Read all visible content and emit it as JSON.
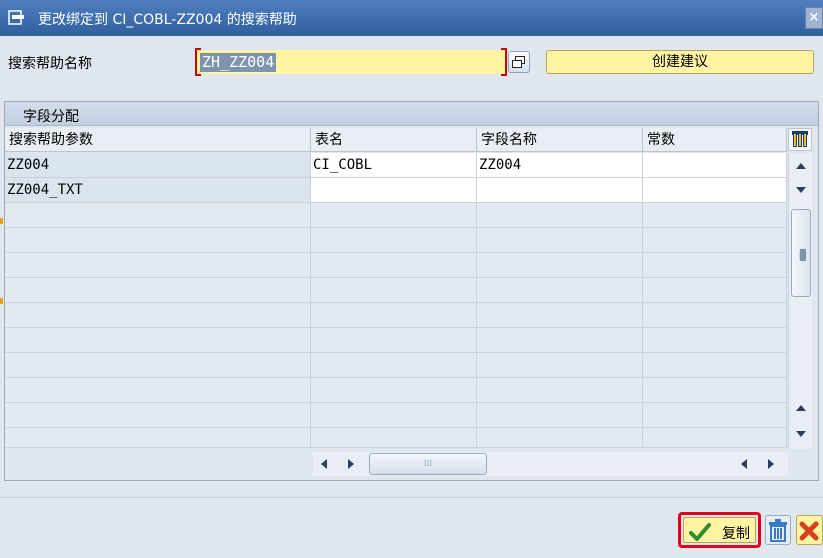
{
  "window": {
    "title": "更改绑定到 CI_COBL-ZZ004 的搜索帮助",
    "close_label": "×"
  },
  "header": {
    "help_label": "搜索帮助名称",
    "help_value": "ZH_ZZ004",
    "suggest_label": "创建建议"
  },
  "group": {
    "title": "字段分配"
  },
  "table": {
    "columns": [
      "搜索帮助参数",
      "表名",
      "字段名称",
      "常数"
    ],
    "rows": [
      [
        "ZZ004",
        "CI_COBL",
        "ZZ004",
        ""
      ],
      [
        "ZZ004_TXT",
        "",
        "",
        ""
      ]
    ]
  },
  "footer": {
    "copy_label": "复制"
  },
  "colors": {
    "title_bar": "#3f6faf",
    "button_yellow": "#fff3a4",
    "highlight_red": "#e3001b"
  }
}
